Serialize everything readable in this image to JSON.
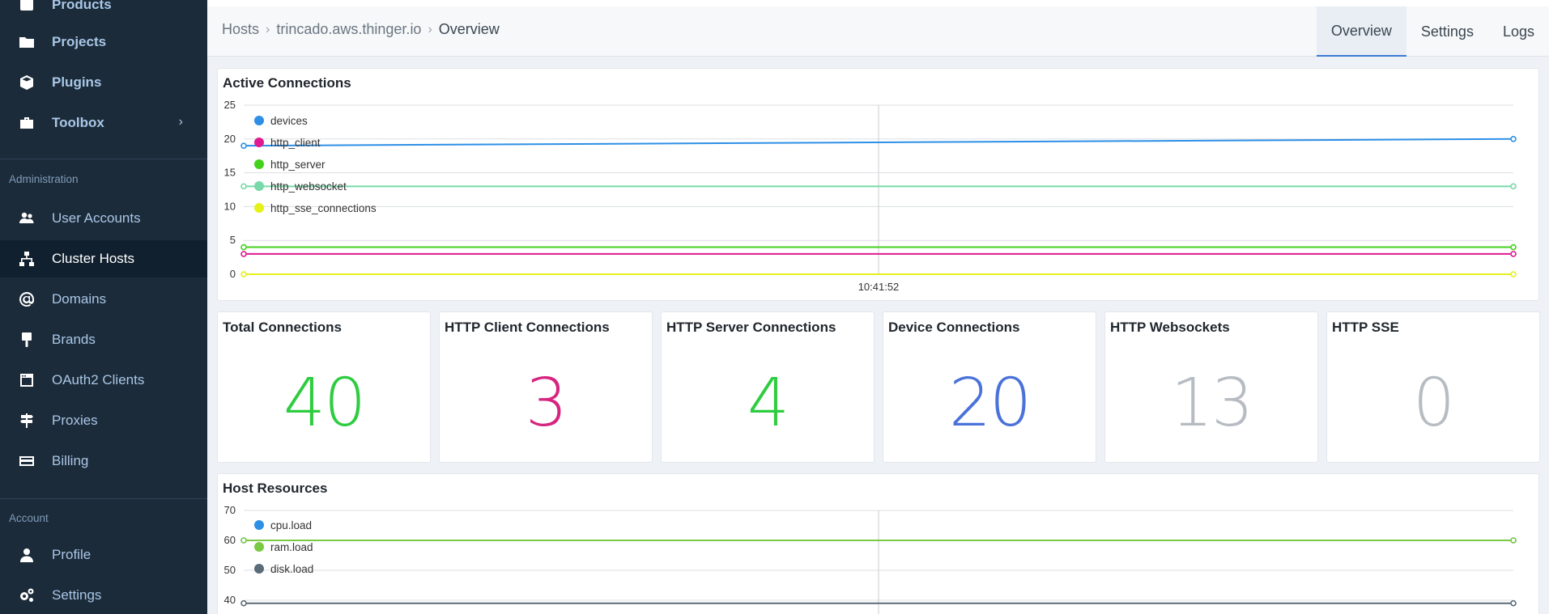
{
  "colors": {
    "sidebar_bg": "#1c2b3a",
    "accent": "#3a7bd5",
    "devices": "#2d8fe6",
    "http_client": "#e01a93",
    "http_server": "#43d21c",
    "http_websocket": "#79d9a8",
    "http_sse_connections": "#e6f019",
    "cpu_load": "#2d8fe6",
    "ram_load": "#7ac943",
    "disk_load": "#5b6b78"
  },
  "sidebar": {
    "top_items": [
      {
        "label": "Products",
        "icon": "products-icon"
      },
      {
        "label": "Projects",
        "icon": "folder-icon"
      },
      {
        "label": "Plugins",
        "icon": "cube-icon"
      },
      {
        "label": "Toolbox",
        "icon": "toolbox-icon"
      }
    ],
    "admin_section": "Administration",
    "admin_items": [
      {
        "label": "User Accounts",
        "icon": "users-icon"
      },
      {
        "label": "Cluster Hosts",
        "icon": "network-icon"
      },
      {
        "label": "Domains",
        "icon": "at-icon"
      },
      {
        "label": "Brands",
        "icon": "paint-brush-icon"
      },
      {
        "label": "OAuth2 Clients",
        "icon": "window-icon"
      },
      {
        "label": "Proxies",
        "icon": "signpost-icon"
      },
      {
        "label": "Billing",
        "icon": "credit-card-icon"
      }
    ],
    "account_section": "Account",
    "account_items": [
      {
        "label": "Profile",
        "icon": "user-icon"
      },
      {
        "label": "Settings",
        "icon": "cogs-icon"
      }
    ]
  },
  "breadcrumb": {
    "root": "Hosts",
    "host": "trincado.aws.thinger.io",
    "current": "Overview"
  },
  "tabs": [
    "Overview",
    "Settings",
    "Logs"
  ],
  "active_connections": {
    "title": "Active Connections"
  },
  "stats": [
    {
      "title": "Total Connections",
      "value": "40",
      "color": "#2ecc40"
    },
    {
      "title": "HTTP Client Connections",
      "value": "3",
      "color": "#d6247f"
    },
    {
      "title": "HTTP Server Connections",
      "value": "4",
      "color": "#2ecc40"
    },
    {
      "title": "Device Connections",
      "value": "20",
      "color": "#4a72d9"
    },
    {
      "title": "HTTP Websockets",
      "value": "13",
      "color": "#b6bcc2"
    },
    {
      "title": "HTTP SSE",
      "value": "0",
      "color": "#b6bcc2"
    }
  ],
  "host_resources": {
    "title": "Host Resources"
  },
  "chart_data": [
    {
      "type": "line",
      "title": "Active Connections",
      "xlabel": "",
      "ylabel": "",
      "x_tick_labels": [
        "10:41:52"
      ],
      "y_ticks": [
        0,
        5,
        10,
        15,
        20,
        25
      ],
      "ylim": [
        0,
        25
      ],
      "grid": true,
      "legend": "top-left",
      "series": [
        {
          "name": "devices",
          "values": [
            19,
            20
          ],
          "color": "#2d8fe6"
        },
        {
          "name": "http_client",
          "values": [
            3,
            3
          ],
          "color": "#e01a93"
        },
        {
          "name": "http_server",
          "values": [
            4,
            4
          ],
          "color": "#43d21c"
        },
        {
          "name": "http_websocket",
          "values": [
            13,
            13
          ],
          "color": "#79d9a8"
        },
        {
          "name": "http_sse_connections",
          "values": [
            0,
            0
          ],
          "color": "#e6f019"
        }
      ]
    },
    {
      "type": "line",
      "title": "Host Resources",
      "xlabel": "",
      "ylabel": "",
      "y_ticks": [
        40,
        50,
        60,
        70
      ],
      "ylim": [
        40,
        70
      ],
      "grid": true,
      "legend": "top-left",
      "series": [
        {
          "name": "cpu.load",
          "values": [
            60,
            60
          ],
          "color": "#2d8fe6"
        },
        {
          "name": "ram.load",
          "values": [
            60,
            60
          ],
          "color": "#7ac943"
        },
        {
          "name": "disk.load",
          "values": [
            39,
            39
          ],
          "color": "#5b6b78"
        }
      ]
    }
  ]
}
